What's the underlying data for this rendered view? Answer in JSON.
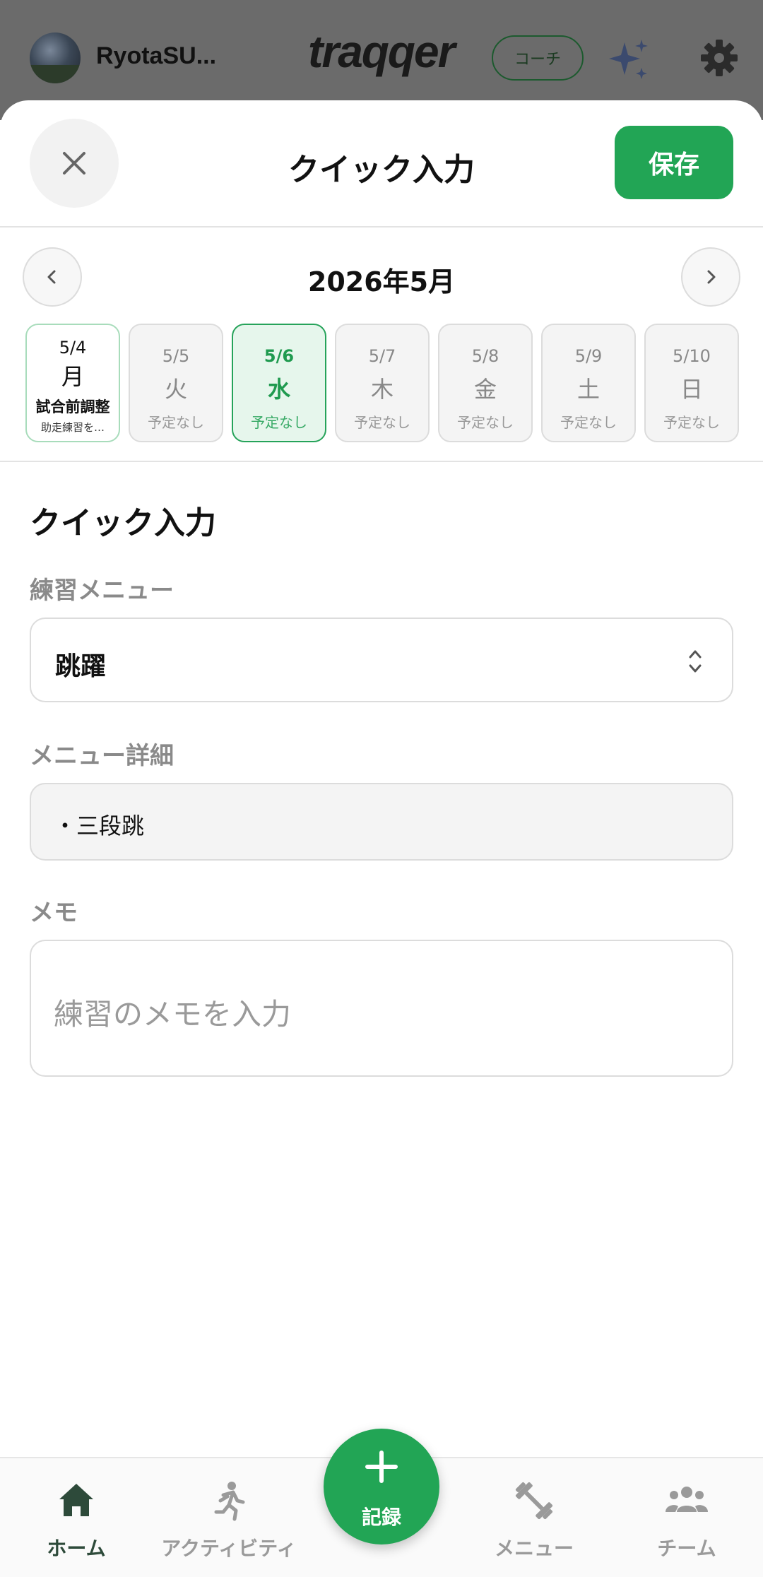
{
  "header": {
    "username": "RyotaSU...",
    "logo_text": "traqqer",
    "role_badge": "コーチ"
  },
  "sheet": {
    "title": "クイック入力",
    "save_label": "保存"
  },
  "calendar": {
    "month_label": "2026年5月",
    "days": [
      {
        "date": "5/4",
        "weekday": "月",
        "event": "試合前調整",
        "detail": "助走練習を…",
        "state": "planned"
      },
      {
        "date": "5/5",
        "weekday": "火",
        "status": "予定なし",
        "state": "empty"
      },
      {
        "date": "5/6",
        "weekday": "水",
        "status": "予定なし",
        "state": "selected"
      },
      {
        "date": "5/7",
        "weekday": "木",
        "status": "予定なし",
        "state": "empty"
      },
      {
        "date": "5/8",
        "weekday": "金",
        "status": "予定なし",
        "state": "empty"
      },
      {
        "date": "5/9",
        "weekday": "土",
        "status": "予定なし",
        "state": "empty"
      },
      {
        "date": "5/10",
        "weekday": "日",
        "status": "予定なし",
        "state": "empty"
      }
    ]
  },
  "form": {
    "section_title": "クイック入力",
    "menu_label": "練習メニュー",
    "menu_value": "跳躍",
    "detail_label": "メニュー詳細",
    "detail_value": "・三段跳",
    "memo_label": "メモ",
    "memo_placeholder": "練習のメモを入力",
    "memo_value": ""
  },
  "bottom_nav": {
    "items": [
      {
        "label": "ホーム",
        "icon": "home-icon",
        "active": true
      },
      {
        "label": "アクティビティ",
        "icon": "run-icon",
        "active": false
      },
      {
        "label": "メニュー",
        "icon": "dumbbell-icon",
        "active": false
      },
      {
        "label": "チーム",
        "icon": "team-icon",
        "active": false
      }
    ],
    "fab_label": "記録"
  },
  "colors": {
    "accent": "#22a555",
    "selected_bg": "#e6f6ec",
    "active_nav": "#2d4a3a"
  }
}
